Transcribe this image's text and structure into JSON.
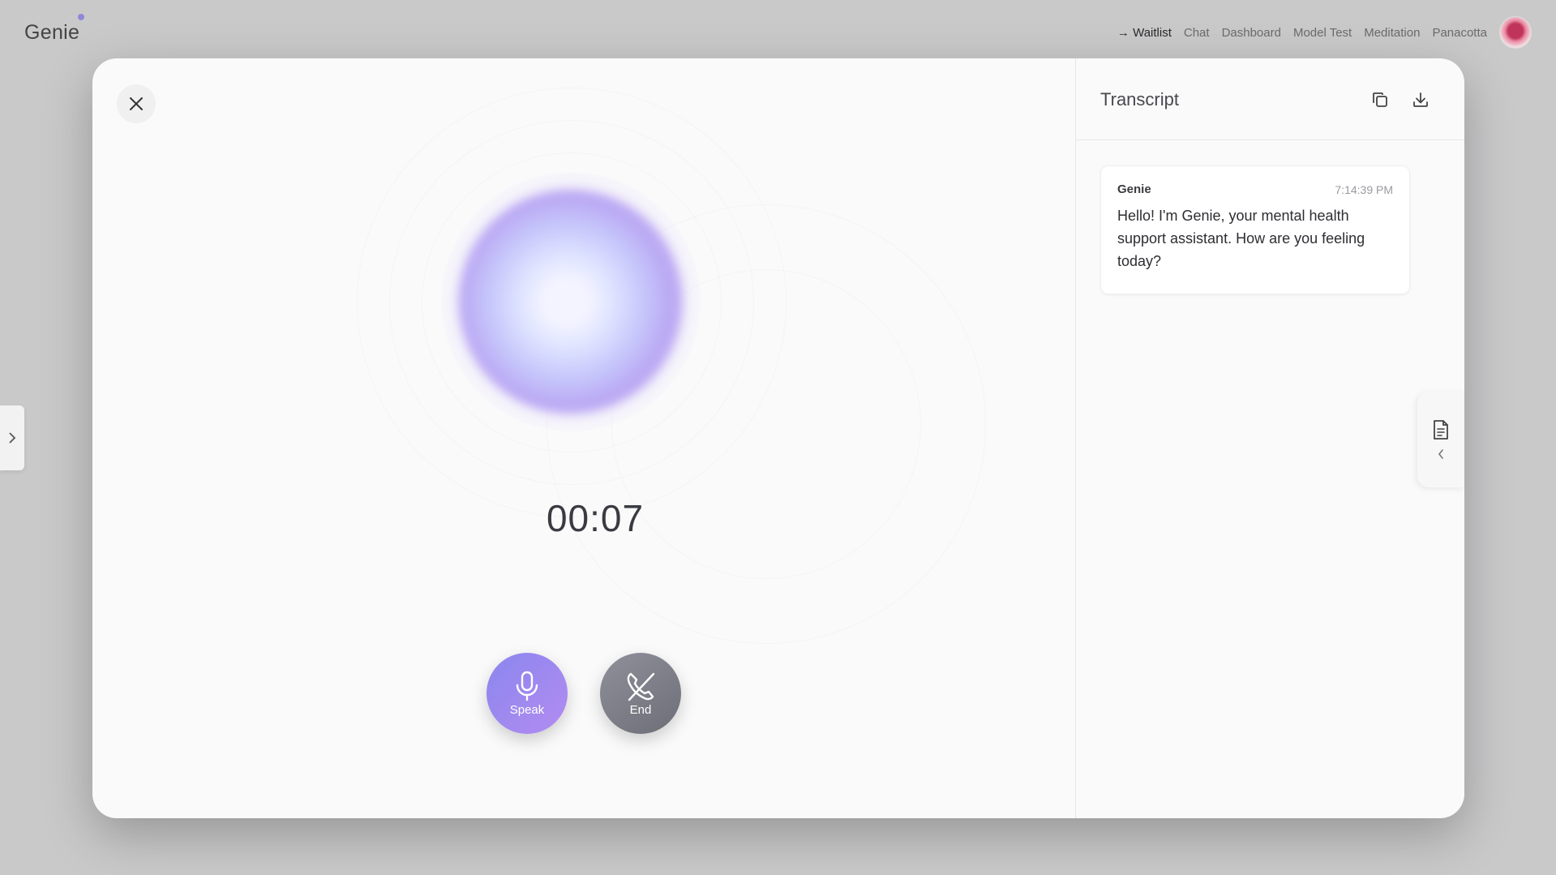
{
  "app": {
    "brand": "Genie"
  },
  "nav": {
    "items": [
      {
        "label": "→ Waitlist",
        "active": true
      },
      {
        "label": "Chat",
        "active": false
      },
      {
        "label": "Dashboard",
        "active": false
      },
      {
        "label": "Model Test",
        "active": false
      },
      {
        "label": "Meditation",
        "active": false
      },
      {
        "label": "Panacotta",
        "active": false
      }
    ],
    "avatar_icon": "tulip-avatar"
  },
  "call": {
    "timer": "00:07",
    "speak_label": "Speak",
    "end_label": "End",
    "close_icon": "close-icon",
    "speak_icon": "microphone-icon",
    "end_icon": "phone-off-icon",
    "colors": {
      "speak": "#9a89ef",
      "end": "#7d7e87",
      "orb": "#c6c6fb"
    }
  },
  "transcript": {
    "title": "Transcript",
    "copy_icon": "copy-icon",
    "download_icon": "download-icon",
    "messages": [
      {
        "sender": "Genie",
        "time": "7:14:39 PM",
        "text": "Hello! I'm Genie, your mental health support assistant. How are you feeling today?"
      }
    ],
    "side_tab_icon": "document-icon"
  }
}
